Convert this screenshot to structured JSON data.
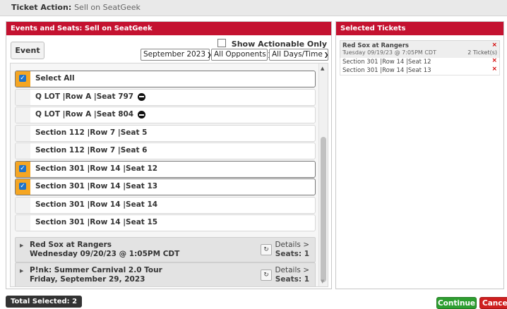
{
  "ticket_action": {
    "label": "Ticket Action:",
    "value": "Sell on SeatGeek"
  },
  "events_panel": {
    "title": "Events and Seats: Sell on SeatGeek",
    "event_button": "Event",
    "show_actionable_label": "Show Actionable Only",
    "show_actionable_checked": false,
    "filters": {
      "month": "September 2023",
      "opponents": "All Opponents",
      "days_time": "All Days/Time"
    },
    "seats": [
      {
        "label": "Select All",
        "checked": true,
        "stop_icon": false
      },
      {
        "label": "Q LOT |Row A |Seat 797",
        "checked": false,
        "stop_icon": true
      },
      {
        "label": "Q LOT |Row A |Seat 804",
        "checked": false,
        "stop_icon": true
      },
      {
        "label": "Section 112 |Row 7 |Seat 5",
        "checked": false,
        "stop_icon": false
      },
      {
        "label": "Section 112 |Row 7 |Seat 6",
        "checked": false,
        "stop_icon": false
      },
      {
        "label": "Section 301 |Row 14 |Seat 12",
        "checked": true,
        "stop_icon": false
      },
      {
        "label": "Section 301 |Row 14 |Seat 13",
        "checked": true,
        "stop_icon": false
      },
      {
        "label": "Section 301 |Row 14 |Seat 14",
        "checked": false,
        "stop_icon": false
      },
      {
        "label": "Section 301 |Row 14 |Seat 15",
        "checked": false,
        "stop_icon": false
      }
    ],
    "events": [
      {
        "name": "Red Sox at Rangers",
        "date": "Wednesday 09/20/23 @ 1:05PM CDT",
        "details": "Details >",
        "seats": "Seats: 1"
      },
      {
        "name": "P!nk: Summer Carnival 2.0 Tour",
        "date": "Friday, September 29, 2023",
        "details": "Details >",
        "seats": "Seats: 1"
      }
    ]
  },
  "selected_panel": {
    "title": "Selected Tickets",
    "event": {
      "name": "Red Sox at Rangers",
      "date": "Tuesday 09/19/23 @ 7:05PM CDT",
      "count": "2 Ticket(s)"
    },
    "tickets": [
      "Section 301 |Row 14 |Seat 12",
      "Section 301 |Row 14 |Seat 13"
    ],
    "remove_glyph": "×"
  },
  "footer": {
    "total_selected": "Total Selected: 2",
    "continue": "Continue",
    "cancel": "Cancel"
  },
  "colors": {
    "header_red": "#c41230",
    "checked_orange": "#f5a623",
    "checkbox_blue": "#1f73c9",
    "continue_green": "#2e9e30",
    "cancel_red": "#cf1f1f"
  }
}
